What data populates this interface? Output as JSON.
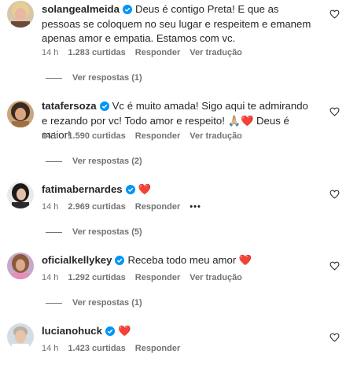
{
  "colors": {
    "text": "#262626",
    "meta": "#737373",
    "verified": "#0095f6",
    "heart": "#ed4956"
  },
  "comments": [
    {
      "username": "solangealmeida",
      "verified": true,
      "text": "Deus é contigo Preta! E que as pessoas se coloquem no seu lugar e respeitem e emanem apenas amor e empatia. Estamos com vc.",
      "time": "14 h",
      "likes": "1.283 curtidas",
      "reply": "Responder",
      "translate": "Ver tradução",
      "view_replies": "Ver respostas (1)"
    },
    {
      "username": "tatafersoza",
      "verified": true,
      "text": "Vc é muito amada! Sigo aqui te admirando e rezando por vc! Todo amor e respeito! 🙏🏼❤️ Deus é maior!",
      "time": "14 h",
      "likes": "1.590 curtidas",
      "reply": "Responder",
      "translate": "Ver tradução",
      "view_replies": "Ver respostas (2)"
    },
    {
      "username": "fatimabernardes",
      "verified": true,
      "text": "❤️",
      "time": "14 h",
      "likes": "2.969 curtidas",
      "reply": "Responder",
      "more_icon": "more-horizontal-icon",
      "more": "•••",
      "view_replies": "Ver respostas (5)"
    },
    {
      "username": "oficialkellykey",
      "verified": true,
      "text": "Receba todo meu amor ❤️",
      "time": "14 h",
      "likes": "1.292 curtidas",
      "reply": "Responder",
      "translate": "Ver tradução",
      "view_replies": "Ver respostas (1)"
    },
    {
      "username": "lucianohuck",
      "verified": true,
      "text": "❤️",
      "time": "14 h",
      "likes": "1.423 curtidas",
      "reply": "Responder"
    }
  ]
}
